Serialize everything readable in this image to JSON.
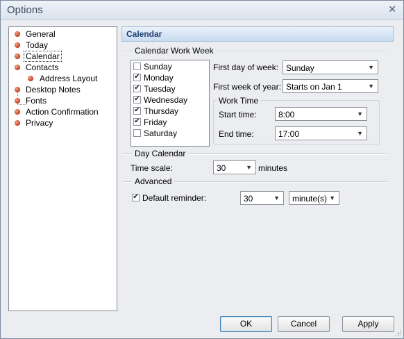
{
  "window": {
    "title": "Options",
    "close": "✕"
  },
  "tree": {
    "items": [
      {
        "label": "General"
      },
      {
        "label": "Today"
      },
      {
        "label": "Calendar"
      },
      {
        "label": "Contacts"
      },
      {
        "label": "Address Layout"
      },
      {
        "label": "Desktop Notes"
      },
      {
        "label": "Fonts"
      },
      {
        "label": "Action Confirmation"
      },
      {
        "label": "Privacy"
      }
    ],
    "selected": "Calendar"
  },
  "panel": {
    "title": "Calendar"
  },
  "work_week": {
    "group_title": "Calendar Work Week",
    "days": [
      {
        "label": "Sunday",
        "checked": false
      },
      {
        "label": "Monday",
        "checked": true
      },
      {
        "label": "Tuesday",
        "checked": true
      },
      {
        "label": "Wednesday",
        "checked": true
      },
      {
        "label": "Thursday",
        "checked": true
      },
      {
        "label": "Friday",
        "checked": true
      },
      {
        "label": "Saturday",
        "checked": false
      }
    ],
    "first_day_label": "First day of week:",
    "first_day_value": "Sunday",
    "first_week_label": "First week of year:",
    "first_week_value": "Starts on Jan 1",
    "work_time_title": "Work Time",
    "start_label": "Start time:",
    "start_value": "8:00",
    "end_label": "End time:",
    "end_value": "17:00"
  },
  "day_calendar": {
    "group_title": "Day Calendar",
    "time_scale_label": "Time scale:",
    "time_scale_value": "30",
    "time_scale_unit": "minutes"
  },
  "advanced": {
    "group_title": "Advanced",
    "reminder_label": "Default reminder:",
    "reminder_checked": true,
    "reminder_value": "30",
    "reminder_unit": "minute(s)"
  },
  "buttons": {
    "ok": "OK",
    "cancel": "Cancel",
    "apply": "Apply"
  }
}
